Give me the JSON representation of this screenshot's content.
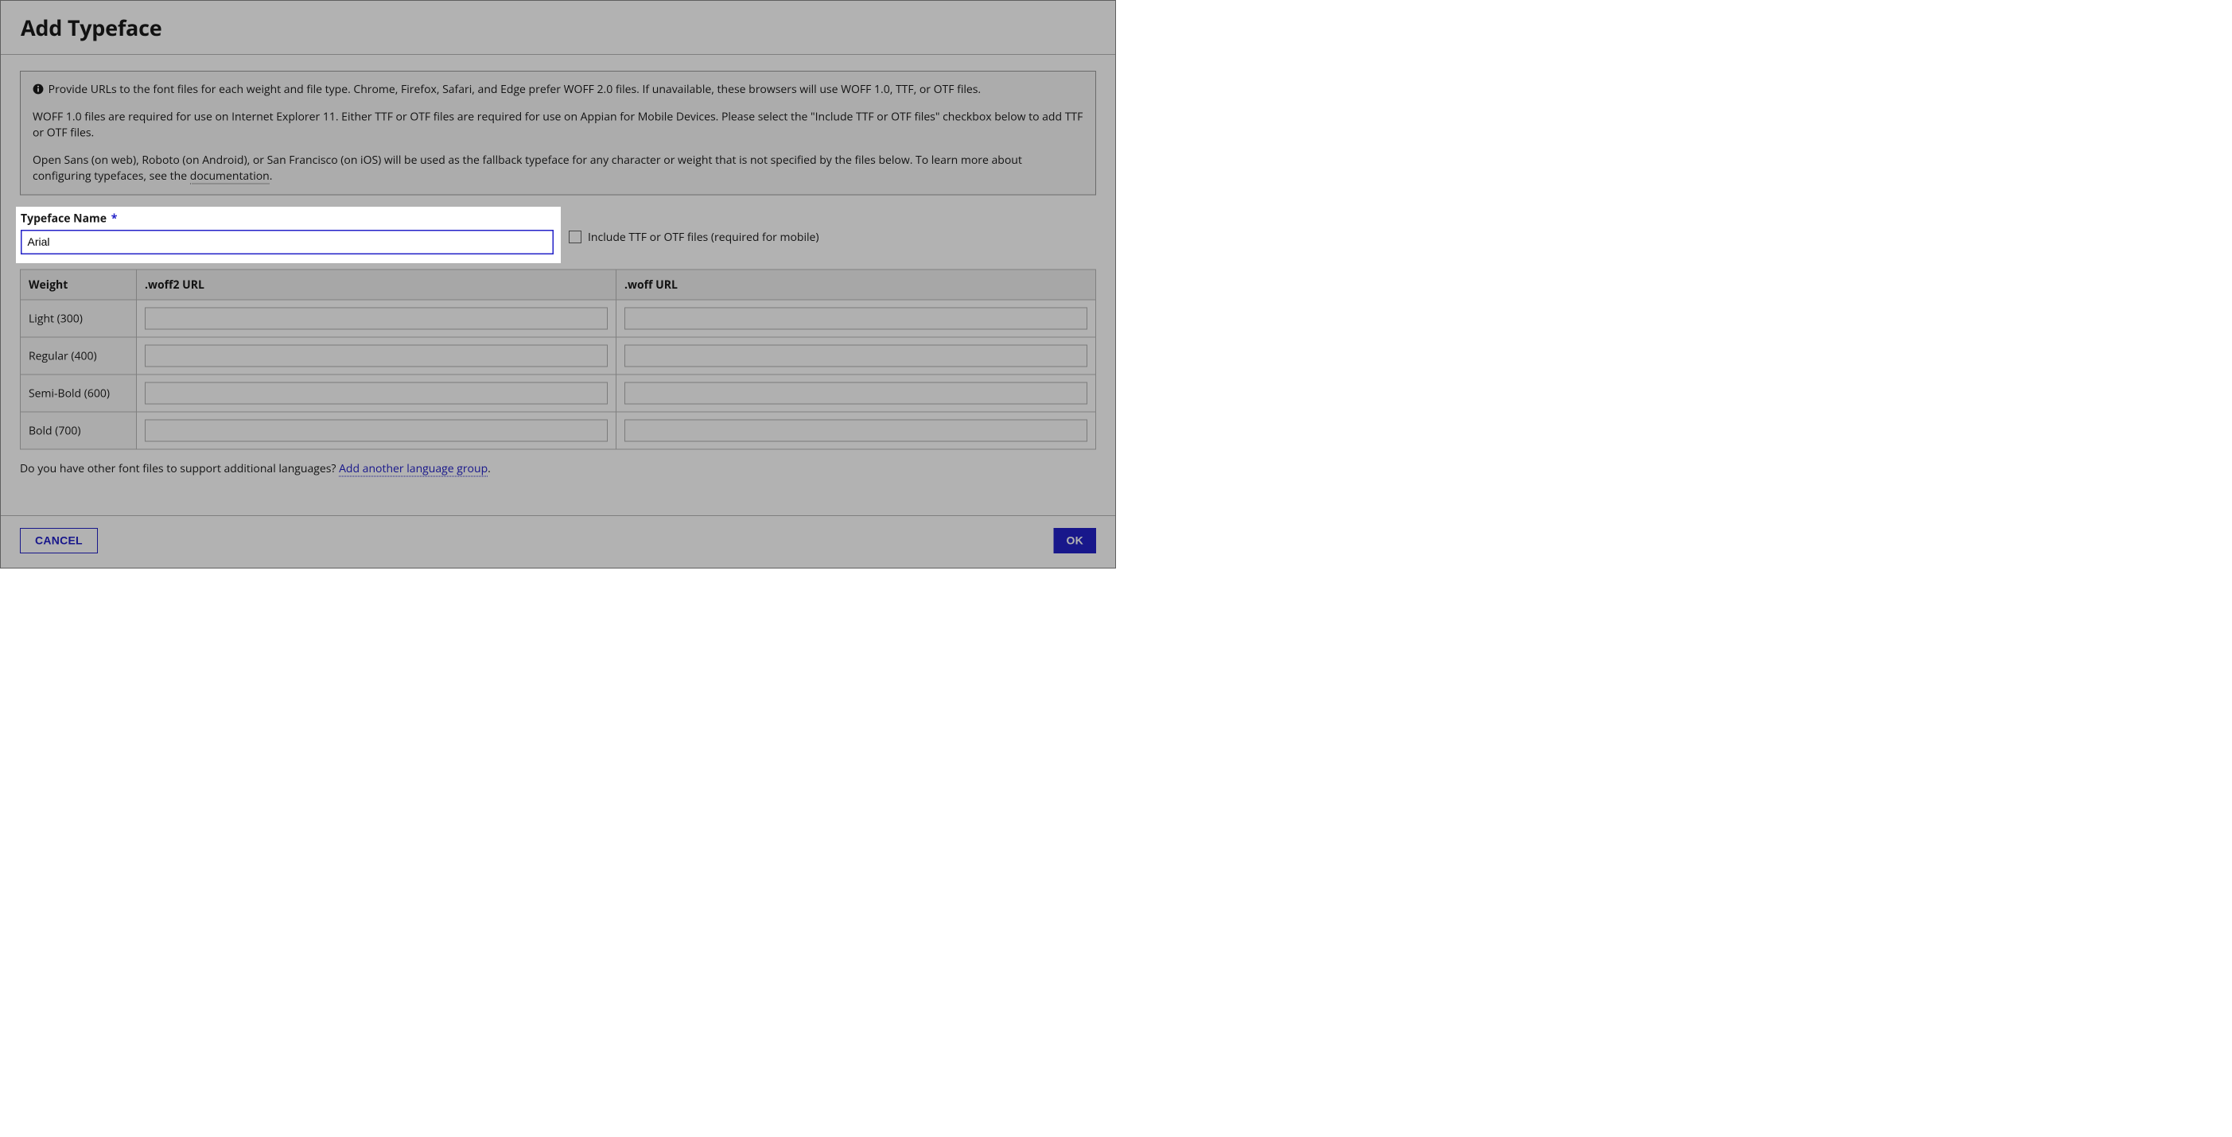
{
  "dialog": {
    "title": "Add Typeface"
  },
  "info": {
    "p1": "Provide URLs to the font files for each weight and file type. Chrome, Firefox, Safari, and Edge prefer WOFF 2.0 files. If unavailable, these browsers will use WOFF 1.0, TTF, or OTF files.",
    "p2": "WOFF 1.0 files are required for use on Internet Explorer 11. Either TTF or OTF files are required for use on Appian for Mobile Devices. Please select the \"Include TTF or OTF files\" checkbox below to add TTF or OTF files.",
    "p3a": "Open Sans (on web), Roboto (on Android), or San Francisco (on iOS) will be used as the fallback typeface for any character or weight that is not specified by the files below. To learn more about configuring typefaces, see the ",
    "doc_link": "documentation",
    "p3b": "."
  },
  "form": {
    "typeface_label": "Typeface Name",
    "typeface_value": "Arial",
    "include_ttf_label": "Include TTF or OTF files (required for mobile)",
    "include_ttf_checked": false
  },
  "table": {
    "col_weight": "Weight",
    "col_woff2": ".woff2 URL",
    "col_woff": ".woff URL",
    "rows": [
      {
        "weight": "Light (300)",
        "woff2": "",
        "woff": ""
      },
      {
        "weight": "Regular (400)",
        "woff2": "",
        "woff": ""
      },
      {
        "weight": "Semi-Bold (600)",
        "woff2": "",
        "woff": ""
      },
      {
        "weight": "Bold (700)",
        "woff2": "",
        "woff": ""
      }
    ]
  },
  "lang_prompt": {
    "q": "Do you have other font files to support additional languages? ",
    "link": "Add another language group",
    "tail": "."
  },
  "buttons": {
    "cancel": "CANCEL",
    "ok": "OK"
  },
  "colors": {
    "accent": "#2322c8"
  }
}
